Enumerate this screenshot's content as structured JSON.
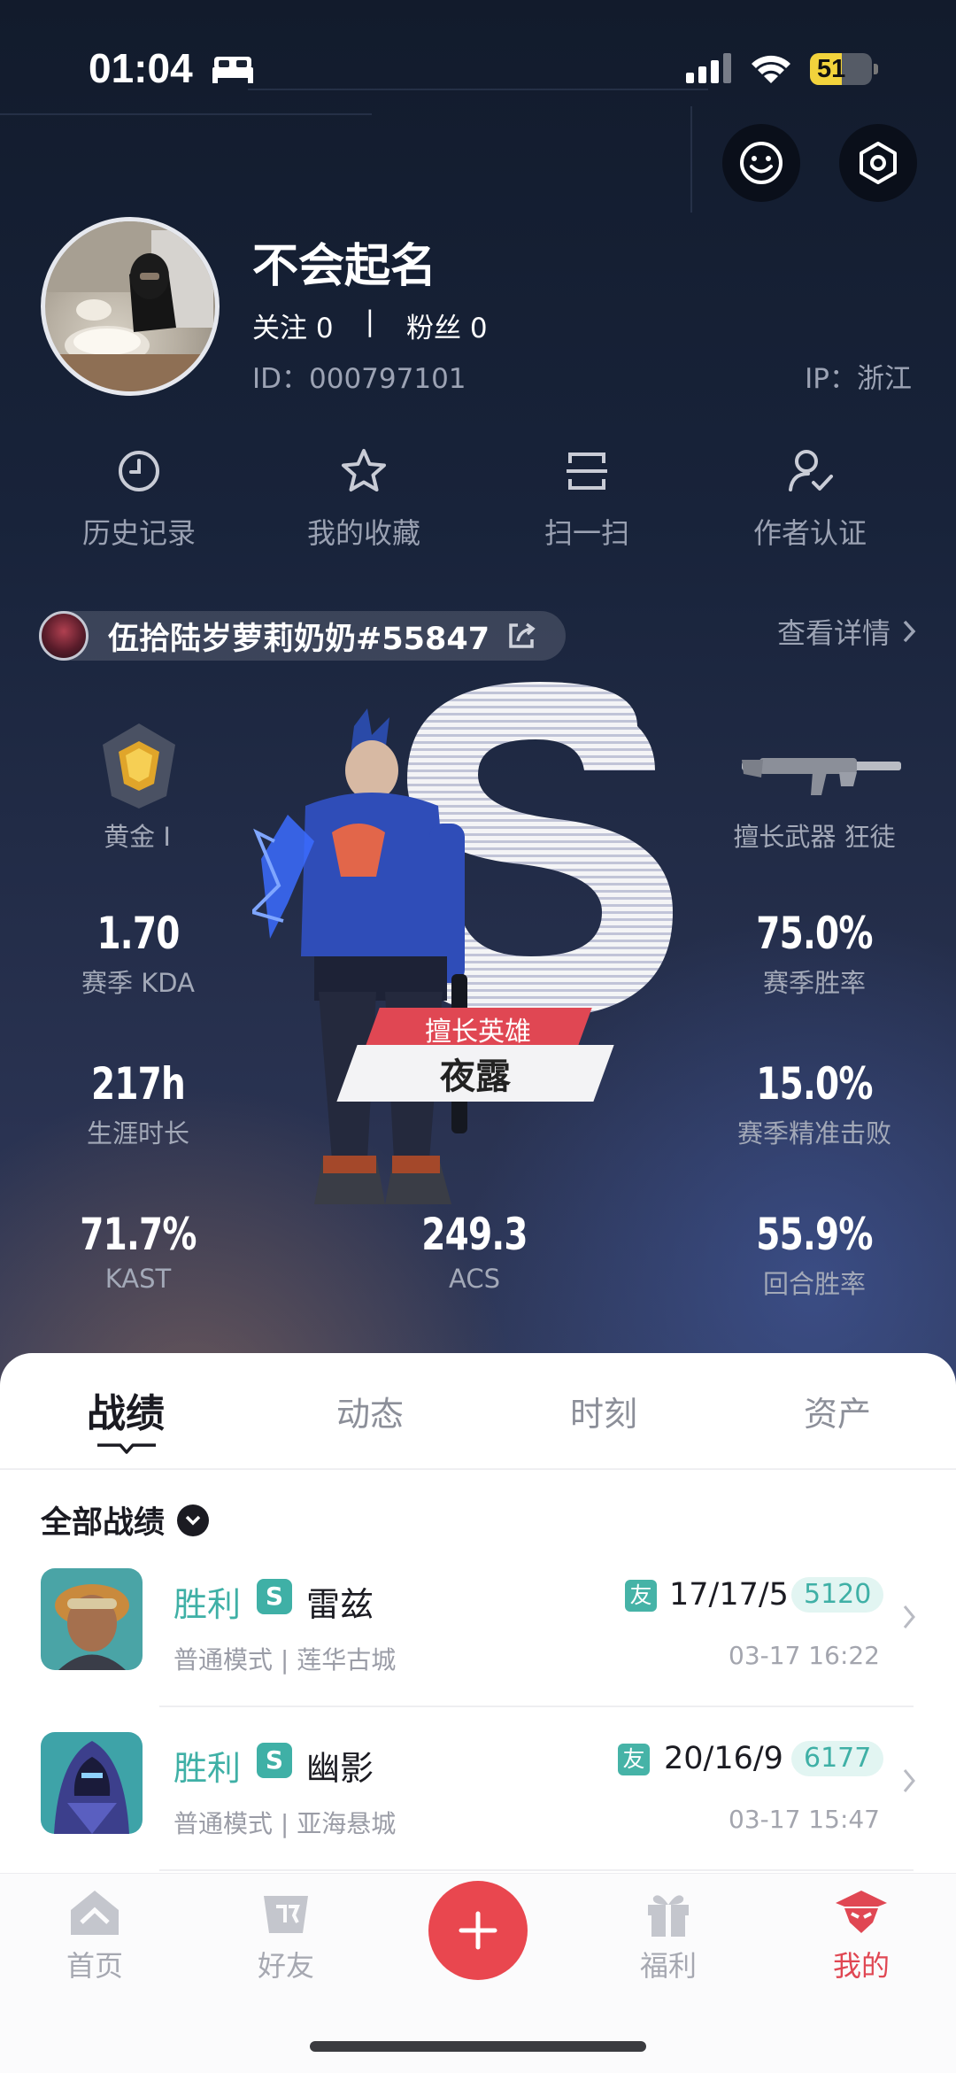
{
  "status_bar": {
    "time": "01:04",
    "battery": "51",
    "battery_level": 0.51
  },
  "profile": {
    "name": "不会起名",
    "following_label": "关注 0",
    "followers_label": "粉丝 0",
    "separator": "|",
    "id": "ID：000797101",
    "ip": "IP：浙江"
  },
  "quick_actions": [
    {
      "label": "历史记录",
      "icon": "history-icon"
    },
    {
      "label": "我的收藏",
      "icon": "star-icon"
    },
    {
      "label": "扫一扫",
      "icon": "scan-icon"
    },
    {
      "label": "作者认证",
      "icon": "author-verify-icon"
    }
  ],
  "game_account": {
    "name": "伍拾陆岁萝莉奶奶#55847",
    "view_details": "查看详情"
  },
  "stats": {
    "rank": "黄金 I",
    "weapon_label": "擅长武器 狂徒",
    "kda_value": "1.70",
    "kda_label": "赛季 KDA",
    "winrate_value": "75.0%",
    "winrate_label": "赛季胜率",
    "hours_value": "217h",
    "hours_label": "生涯时长",
    "headshot_value": "15.0%",
    "headshot_label": "赛季精准击败",
    "kast_value": "71.7%",
    "kast_label": "KAST",
    "acs_value": "249.3",
    "acs_label": "ACS",
    "round_winrate_value": "55.9%",
    "round_winrate_label": "回合胜率",
    "agent_tag": "擅长英雄",
    "agent_name": "夜露"
  },
  "tabs": [
    "战绩",
    "动态",
    "时刻",
    "资产"
  ],
  "filter_label": "全部战绩",
  "matches": [
    {
      "result": "胜利",
      "rank": "S",
      "agent": "雷兹",
      "mode": "普通模式 | 莲华古城",
      "friend": "友",
      "kda": "17/17/5",
      "score": "5120",
      "time": "03-17 16:22"
    },
    {
      "result": "胜利",
      "rank": "S",
      "agent": "幽影",
      "mode": "普通模式 | 亚海悬城",
      "friend": "友",
      "kda": "20/16/9",
      "score": "6177",
      "time": "03-17 15:47"
    }
  ],
  "nav": [
    {
      "label": "首页",
      "icon": "home-icon"
    },
    {
      "label": "好友",
      "icon": "friends-icon"
    },
    {
      "label": "福利",
      "icon": "gift-icon"
    },
    {
      "label": "我的",
      "icon": "profile-icon"
    }
  ],
  "colors": {
    "accent": "#e04753",
    "win": "#3fb0a6"
  }
}
